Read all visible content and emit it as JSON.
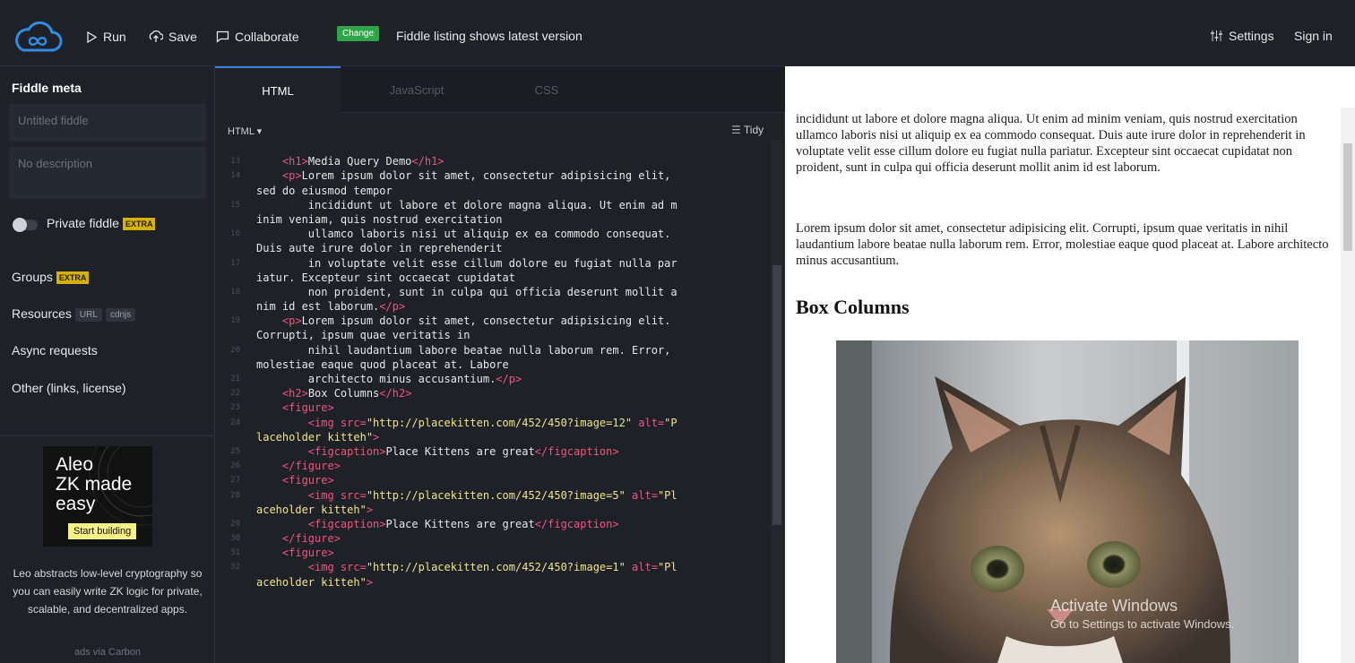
{
  "topbar": {
    "run": "Run",
    "save": "Save",
    "collaborate": "Collaborate",
    "change_badge": "Change",
    "change_text": "Fiddle listing shows latest version",
    "settings": "Settings",
    "sign_in": "Sign in"
  },
  "sidebar": {
    "title": "Fiddle meta",
    "title_placeholder": "Untitled fiddle",
    "description_placeholder": "No description",
    "private_label": "Private fiddle",
    "extra_badge": "EXTRA",
    "groups": "Groups",
    "resources": "Resources",
    "url_pill": "URL",
    "cdnjs_pill": "cdnjs",
    "async": "Async requests",
    "other": "Other (links, license)"
  },
  "ad": {
    "title": "Aleo\nZK made\neasy",
    "button": "Start building",
    "text": "Leo abstracts low-level cryptography so you can easily write ZK logic for private, scalable, and decentralized apps.",
    "via": "ads via Carbon"
  },
  "editor": {
    "tabs": [
      "HTML",
      "JavaScript",
      "CSS"
    ],
    "language": "HTML ▾",
    "tidy": "Tidy",
    "lines": [
      {
        "n": "",
        "parts": [
          [
            "",
            "    "
          ]
        ]
      },
      {
        "n": "13",
        "parts": [
          [
            "",
            "    "
          ],
          [
            "tag",
            "<h1>"
          ],
          [
            "",
            "Media Query Demo"
          ],
          [
            "tag",
            "</h1>"
          ]
        ]
      },
      {
        "n": "14",
        "parts": [
          [
            "",
            "    "
          ],
          [
            "tag",
            "<p>"
          ],
          [
            "",
            "Lorem ipsum dolor sit amet, consectetur adipisicing elit,"
          ]
        ]
      },
      {
        "n": "",
        "parts": [
          [
            "",
            "sed do eiusmod tempor"
          ]
        ]
      },
      {
        "n": "15",
        "parts": [
          [
            "",
            "        incididunt ut labore et dolore magna aliqua. Ut enim ad m"
          ]
        ]
      },
      {
        "n": "",
        "parts": [
          [
            "",
            "inim veniam, quis nostrud exercitation"
          ]
        ]
      },
      {
        "n": "16",
        "parts": [
          [
            "",
            "        ullamco laboris nisi ut aliquip ex ea commodo consequat."
          ]
        ]
      },
      {
        "n": "",
        "parts": [
          [
            "",
            "Duis aute irure dolor in reprehenderit"
          ]
        ]
      },
      {
        "n": "17",
        "parts": [
          [
            "",
            "        in voluptate velit esse cillum dolore eu fugiat nulla par"
          ]
        ]
      },
      {
        "n": "",
        "parts": [
          [
            "",
            "iatur. Excepteur sint occaecat cupidatat"
          ]
        ]
      },
      {
        "n": "18",
        "parts": [
          [
            "",
            "        non proident, sunt in culpa qui officia deserunt mollit a"
          ]
        ]
      },
      {
        "n": "",
        "parts": [
          [
            "",
            "nim id est laborum."
          ],
          [
            "tag",
            "</p>"
          ]
        ]
      },
      {
        "n": "19",
        "parts": [
          [
            "",
            "    "
          ],
          [
            "tag",
            "<p>"
          ],
          [
            "",
            "Lorem ipsum dolor sit amet, consectetur adipisicing elit."
          ]
        ]
      },
      {
        "n": "",
        "parts": [
          [
            "",
            "Corrupti, ipsum quae veritatis in"
          ]
        ]
      },
      {
        "n": "20",
        "parts": [
          [
            "",
            "        nihil laudantium labore beatae nulla laborum rem. Error,"
          ]
        ]
      },
      {
        "n": "",
        "parts": [
          [
            "",
            "molestiae eaque quod placeat at. Labore"
          ]
        ]
      },
      {
        "n": "21",
        "parts": [
          [
            "",
            "        architecto minus accusantium."
          ],
          [
            "tag",
            "</p>"
          ]
        ]
      },
      {
        "n": "22",
        "parts": [
          [
            "",
            "    "
          ],
          [
            "tag",
            "<h2>"
          ],
          [
            "",
            "Box Columns"
          ],
          [
            "tag",
            "</h2>"
          ]
        ]
      },
      {
        "n": "23",
        "parts": [
          [
            "",
            "    "
          ],
          [
            "tag",
            "<figure>"
          ]
        ]
      },
      {
        "n": "24",
        "parts": [
          [
            "",
            "        "
          ],
          [
            "tag",
            "<img "
          ],
          [
            "tag",
            "src="
          ],
          [
            "str",
            "\"http://placekitten.com/452/450?image=12\""
          ],
          [
            "tag",
            " alt="
          ],
          [
            "str",
            "\"P"
          ]
        ]
      },
      {
        "n": "",
        "parts": [
          [
            "str",
            "laceholder kitteh\""
          ],
          [
            "tag",
            ">"
          ]
        ]
      },
      {
        "n": "25",
        "parts": [
          [
            "",
            "        "
          ],
          [
            "tag",
            "<figcaption>"
          ],
          [
            "",
            "Place Kittens are great"
          ],
          [
            "tag",
            "</figcaption>"
          ]
        ]
      },
      {
        "n": "26",
        "parts": [
          [
            "",
            "    "
          ],
          [
            "tag",
            "</figure>"
          ]
        ]
      },
      {
        "n": "27",
        "parts": [
          [
            "",
            "    "
          ],
          [
            "tag",
            "<figure>"
          ]
        ]
      },
      {
        "n": "28",
        "parts": [
          [
            "",
            "        "
          ],
          [
            "tag",
            "<img "
          ],
          [
            "tag",
            "src="
          ],
          [
            "str",
            "\"http://placekitten.com/452/450?image=5\""
          ],
          [
            "tag",
            " alt="
          ],
          [
            "str",
            "\"Pl"
          ]
        ]
      },
      {
        "n": "",
        "parts": [
          [
            "str",
            "aceholder kitteh\""
          ],
          [
            "tag",
            ">"
          ]
        ]
      },
      {
        "n": "29",
        "parts": [
          [
            "",
            "        "
          ],
          [
            "tag",
            "<figcaption>"
          ],
          [
            "",
            "Place Kittens are great"
          ],
          [
            "tag",
            "</figcaption>"
          ]
        ]
      },
      {
        "n": "30",
        "parts": [
          [
            "",
            "    "
          ],
          [
            "tag",
            "</figure>"
          ]
        ]
      },
      {
        "n": "31",
        "parts": [
          [
            "",
            "    "
          ],
          [
            "tag",
            "<figure>"
          ]
        ]
      },
      {
        "n": "32",
        "parts": [
          [
            "",
            "        "
          ],
          [
            "tag",
            "<img "
          ],
          [
            "tag",
            "src="
          ],
          [
            "str",
            "\"http://placekitten.com/452/450?image=1\""
          ],
          [
            "tag",
            " alt="
          ],
          [
            "str",
            "\"Pl"
          ]
        ]
      },
      {
        "n": "",
        "parts": [
          [
            "str",
            "aceholder kitteh\""
          ],
          [
            "tag",
            ">"
          ]
        ]
      }
    ]
  },
  "preview": {
    "p1": "incididunt ut labore et dolore magna aliqua. Ut enim ad minim veniam, quis nostrud exercitation ullamco laboris nisi ut aliquip ex ea commodo consequat. Duis aute irure dolor in reprehenderit in voluptate velit esse cillum dolore eu fugiat nulla pariatur. Excepteur sint occaecat cupidatat non proident, sunt in culpa qui officia deserunt mollit anim id est laborum.",
    "p2": "Lorem ipsum dolor sit amet, consectetur adipisicing elit. Corrupti, ipsum quae veritatis in nihil laudantium labore beatae nulla laborum rem. Error, molestiae eaque quod placeat at. Labore architecto minus accusantium.",
    "h2": "Box Columns",
    "watermark_title": "Activate Windows",
    "watermark_sub": "Go to Settings to activate Windows."
  },
  "colors": {
    "accent": "#3d7de0",
    "change_green": "#2fa44a",
    "extra_yellow": "#d7b100",
    "tag_pink": "#f0557a",
    "string_yellow": "#f3e28a"
  },
  "icons": [
    "jsfiddle-logo-icon",
    "play-icon",
    "save-icon",
    "chat-icon",
    "sliders-icon",
    "menu-icon"
  ]
}
